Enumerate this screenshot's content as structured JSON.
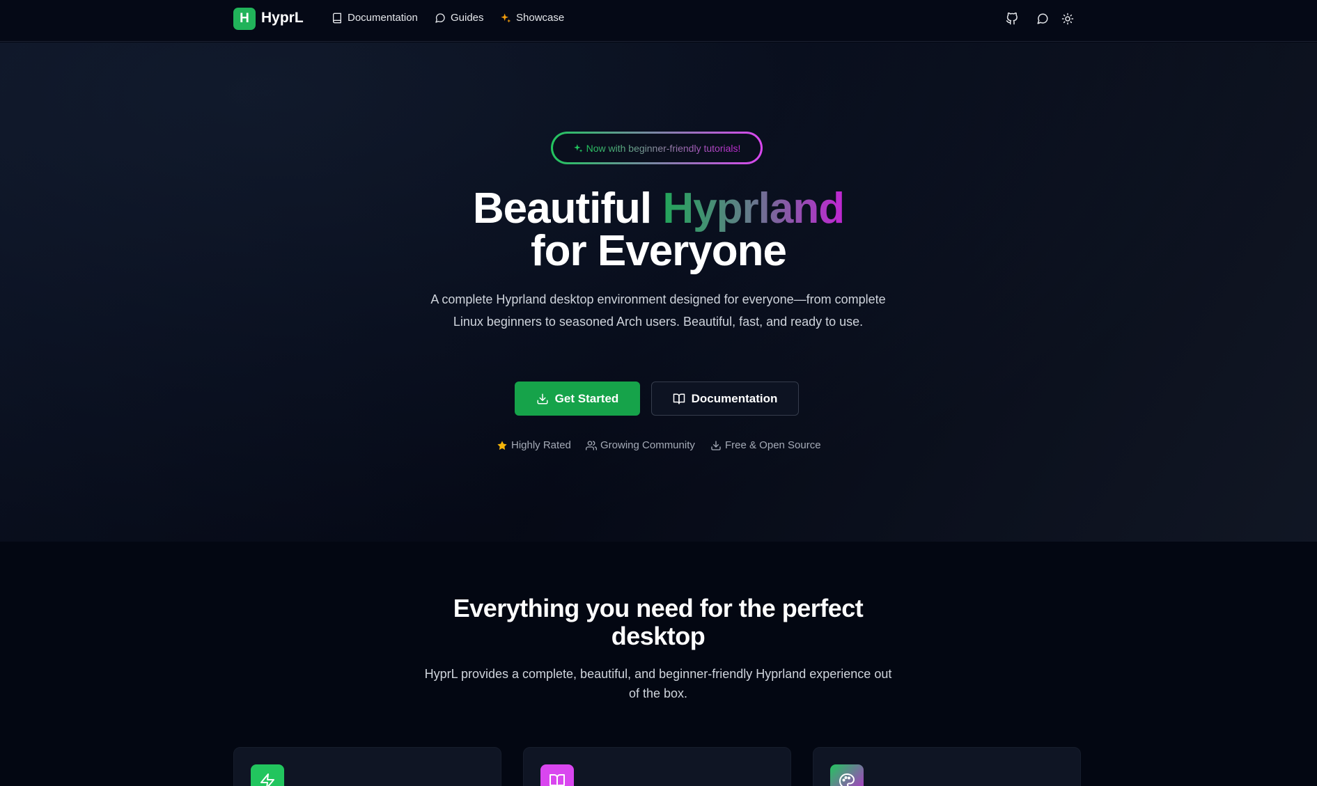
{
  "brand": {
    "logo_letter": "H",
    "name": "HyprL"
  },
  "nav": {
    "documentation": "Documentation",
    "guides": "Guides",
    "showcase": "Showcase"
  },
  "header_icons": [
    "github-icon",
    "chat-icon",
    "theme-toggle-icon"
  ],
  "hero": {
    "badge": "Now with beginner-friendly tutorials!",
    "title_part1": "Beautiful ",
    "title_highlight": "Hyprland",
    "title_line2": "for Everyone",
    "description": "A complete Hyprland desktop environment designed for everyone—from complete Linux beginners to seasoned Arch users. Beautiful, fast, and ready to use.",
    "primary_button": "Get Started",
    "secondary_button": "Documentation",
    "stats": {
      "rated": "Highly Rated",
      "community": "Growing Community",
      "opensource": "Free & Open Source"
    }
  },
  "features": {
    "title": "Everything you need for the perfect desktop",
    "description": "HyprL provides a complete, beautiful, and beginner-friendly Hyprland experience out of the box.",
    "cards": [
      {
        "icon": "lightning-icon",
        "color": "#22c55e"
      },
      {
        "icon": "book-icon",
        "color": "#d946ef"
      },
      {
        "icon": "palette-icon",
        "color": "#6b8f8a"
      }
    ]
  },
  "colors": {
    "accent_green": "#16a34a",
    "accent_purple": "#c026d3",
    "background": "#030712"
  }
}
